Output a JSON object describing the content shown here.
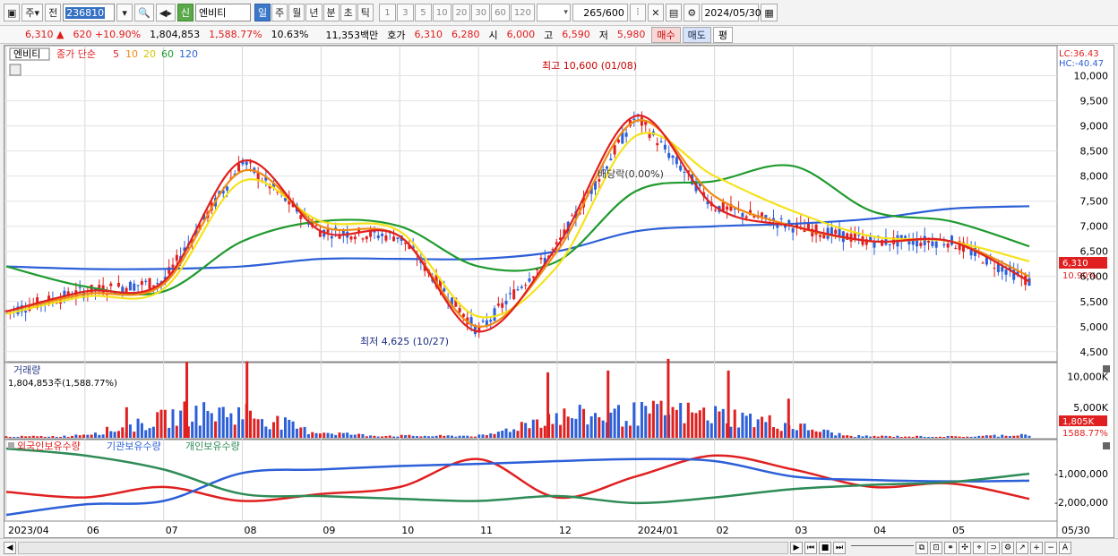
{
  "toolbar": {
    "market_label": "주",
    "prev_label": "전",
    "code": "236810",
    "new_tag": "신",
    "name": "엔비티",
    "periods": [
      "일",
      "주",
      "월",
      "년",
      "분",
      "초",
      "틱"
    ],
    "active_period": "일",
    "intervals": [
      "1",
      "3",
      "5",
      "10",
      "20",
      "30",
      "60",
      "120"
    ],
    "count": "265",
    "count_max": "/600",
    "date": "2024/05/30"
  },
  "pricebar": {
    "price": "6,310",
    "change": "620",
    "change_pct": "+10.90%",
    "volume": "1,804,853",
    "volume_ratio": "1,588.77%",
    "turnover": "10.63%",
    "amount": "11,353백만",
    "quote_label": "호가",
    "ask": "6,310",
    "bid": "6,280",
    "open_label": "시",
    "open": "6,000",
    "high_label": "고",
    "high": "6,590",
    "low_label": "저",
    "low": "5,980",
    "buy_label": "매수",
    "sell_label": "매도",
    "flat_label": "평"
  },
  "price_panel": {
    "stock_name": "엔비티",
    "ma_label": "종가 단순",
    "ma_periods": [
      "5",
      "10",
      "20",
      "60",
      "120"
    ],
    "ma_colors": [
      "#e02020",
      "#f08a10",
      "#f5e21a",
      "#1f9a2e",
      "#2c5fd8"
    ],
    "lc": "LC:36.43",
    "hc": "HC:-40.47",
    "y_ticks": [
      "10,000",
      "9,500",
      "9,000",
      "8,500",
      "8,000",
      "7,500",
      "7,000",
      "6,500",
      "6,000",
      "5,500",
      "5,000",
      "4,500"
    ],
    "current_price_tag": "6,310",
    "current_pct_tag": "10.90%",
    "high_annotation": "최고 10,600 (01/08)",
    "low_annotation": "최저 4,625 (10/27)",
    "dividend_annotation": "배당락(0.00%)"
  },
  "volume_panel": {
    "title": "거래량",
    "value_label": "1,804,853주(1,588.77%)",
    "y_ticks": [
      "10,000K",
      "5,000K"
    ],
    "current_tag": "1,805K",
    "current_pct": "1588.77%"
  },
  "holder_panel": {
    "series_names": [
      "외국인보유수량",
      "기관보유수량",
      "개인보유수량"
    ],
    "series_colors": [
      "#e02020",
      "#2c5fd8",
      "#2e8b57"
    ],
    "y_ticks": [
      "-1,000,000",
      "-2,000,000"
    ]
  },
  "x_axis": {
    "labels": [
      "2023/04",
      "06",
      "07",
      "08",
      "09",
      "10",
      "11",
      "12",
      "2024/01",
      "02",
      "03",
      "04",
      "05"
    ],
    "end_label": "05/30"
  },
  "chart_data": [
    {
      "type": "line",
      "title": "",
      "xlabel": "",
      "ylabel": "",
      "ylim": [
        4300,
        10600
      ],
      "x": [
        "2023/04",
        "06",
        "07",
        "08",
        "09",
        "10",
        "11",
        "12",
        "2024/01",
        "02",
        "03",
        "04",
        "05",
        "05/30"
      ],
      "series": [
        {
          "name": "5",
          "values": [
            5300,
            5700,
            5900,
            8300,
            6900,
            6800,
            4900,
            6600,
            9200,
            7400,
            7000,
            6700,
            6700,
            5900
          ]
        },
        {
          "name": "10",
          "values": [
            5300,
            5650,
            5850,
            8100,
            7000,
            6800,
            5000,
            6500,
            9100,
            7600,
            7000,
            6700,
            6700,
            6000
          ]
        },
        {
          "name": "20",
          "values": [
            5250,
            5600,
            5750,
            7900,
            7100,
            6900,
            5200,
            6200,
            8800,
            8000,
            7300,
            6800,
            6700,
            6300
          ]
        },
        {
          "name": "60",
          "values": [
            6200,
            5800,
            5700,
            6700,
            7100,
            7000,
            6200,
            6300,
            7700,
            7900,
            8200,
            7300,
            7100,
            6600
          ]
        },
        {
          "name": "120",
          "values": [
            6200,
            6150,
            6150,
            6200,
            6350,
            6350,
            6350,
            6500,
            6900,
            7000,
            7050,
            7150,
            7350,
            7400
          ]
        }
      ]
    },
    {
      "type": "bar",
      "title": "",
      "ylabel": "",
      "ylim": [
        0,
        12000
      ],
      "categories": [
        "2023/04",
        "06",
        "07 a",
        "07 b",
        "07 c",
        "08",
        "09",
        "10",
        "11",
        "12 a",
        "12 b",
        "12 c",
        "2024/01",
        "02",
        "03",
        "04",
        "05",
        "05/30"
      ],
      "values": [
        600,
        800,
        5000,
        12400,
        12500,
        3500,
        1200,
        900,
        1100,
        10700,
        11000,
        12900,
        11000,
        6400,
        900,
        700,
        600,
        1805
      ]
    }
  ]
}
